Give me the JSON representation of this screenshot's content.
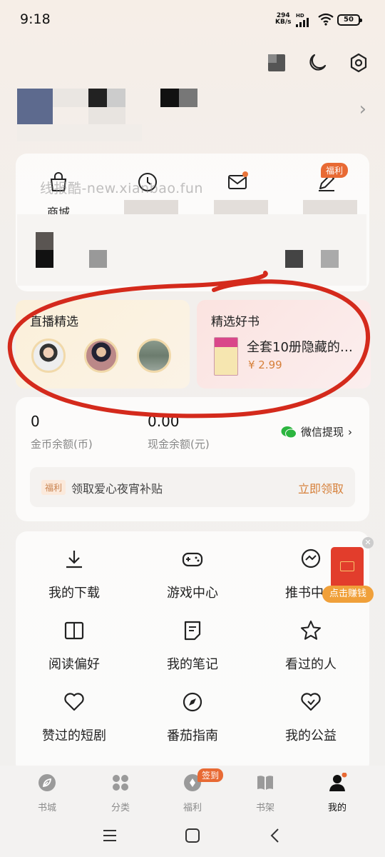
{
  "status_bar": {
    "time": "9:18",
    "net_speed": "294",
    "net_unit": "KB/s",
    "hd": "HD",
    "battery": "50"
  },
  "top_actions": [
    "scan-icon",
    "moon-icon",
    "settings-icon"
  ],
  "watermark": "线报酷-new.xianbao.fun",
  "quick_actions": [
    {
      "label": "商城",
      "icon": "bag-icon"
    },
    {
      "label": "",
      "icon": "clock-icon"
    },
    {
      "label": "",
      "icon": "mail-icon"
    },
    {
      "label": "",
      "icon": "pen-icon",
      "badge": "福利"
    }
  ],
  "live": {
    "title": "直播精选"
  },
  "book": {
    "title": "精选好书",
    "name": "全套10册隐藏的…",
    "price": "¥ 2.99"
  },
  "wallet": {
    "coins": "0",
    "coins_label": "金币余额(币)",
    "cash": "0.00",
    "cash_label": "现金余额(元)",
    "withdraw": "微信提现",
    "withdraw_chevron": "›"
  },
  "welfare": {
    "tag": "福利",
    "text": "领取爱心夜宵补贴",
    "action": "立即领取"
  },
  "grid": [
    {
      "label": "我的下载",
      "icon": "download-icon"
    },
    {
      "label": "游戏中心",
      "icon": "gamepad-icon"
    },
    {
      "label": "推书中心",
      "icon": "chat-icon"
    },
    {
      "label": "阅读偏好",
      "icon": "book-open-icon"
    },
    {
      "label": "我的笔记",
      "icon": "note-icon"
    },
    {
      "label": "看过的人",
      "icon": "star-icon"
    },
    {
      "label": "赞过的短剧",
      "icon": "heart-icon"
    },
    {
      "label": "番茄指南",
      "icon": "compass-icon"
    },
    {
      "label": "我的公益",
      "icon": "charity-heart-icon"
    }
  ],
  "float_ad": {
    "label": "点击赚钱"
  },
  "bottom_nav": [
    {
      "label": "书城",
      "icon": "leaf-icon"
    },
    {
      "label": "分类",
      "icon": "grid-dots-icon"
    },
    {
      "label": "福利",
      "icon": "coin-icon",
      "badge": "签到"
    },
    {
      "label": "书架",
      "icon": "bookshelf-icon"
    },
    {
      "label": "我的",
      "icon": "person-icon",
      "active": true
    }
  ],
  "colors": {
    "accent": "#d6803a",
    "active_nav": "#111111",
    "badge": "#e86a34",
    "annotation_red": "#d42a1c"
  }
}
